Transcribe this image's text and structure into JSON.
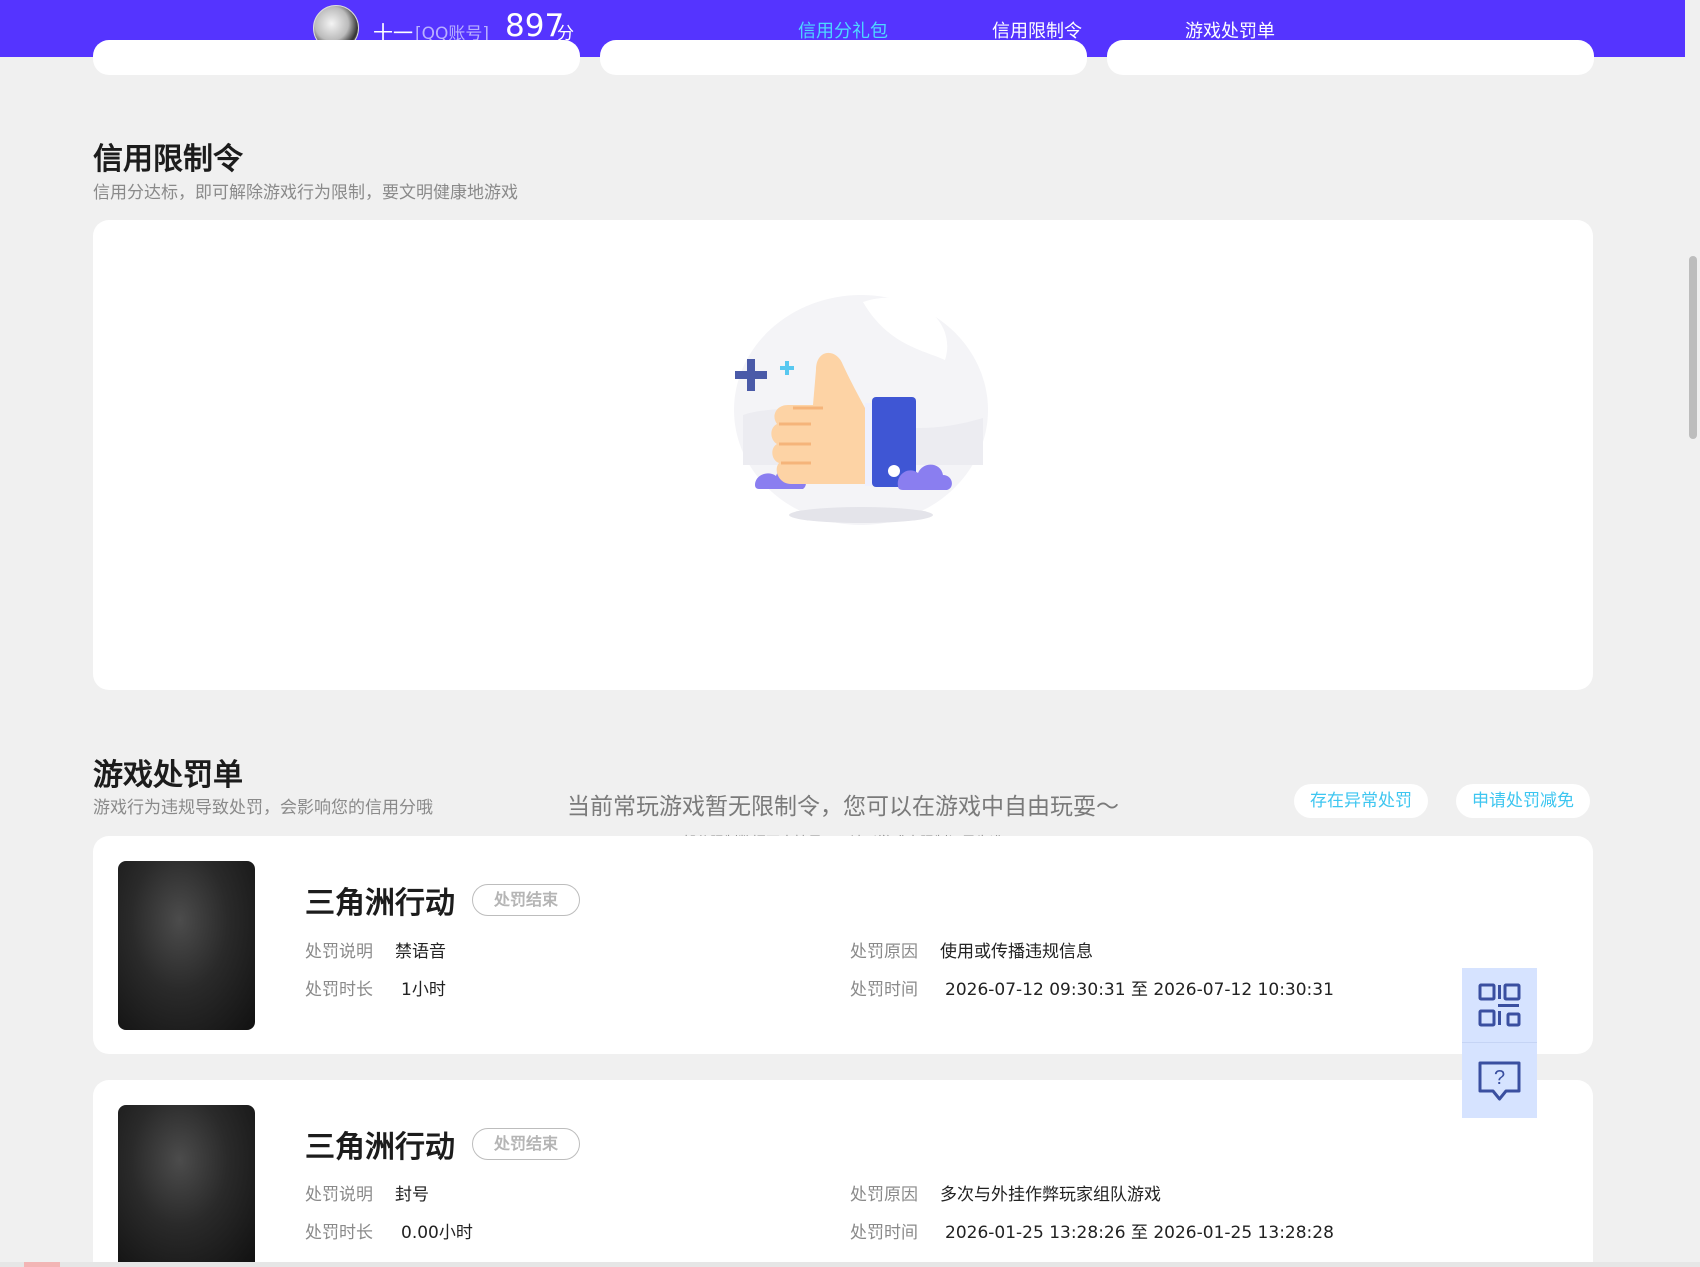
{
  "header": {
    "user_name": "十一",
    "account_type": "[QQ账号]",
    "score": "897",
    "score_unit": "分",
    "nav": [
      {
        "label": "信用分礼包",
        "active": true
      },
      {
        "label": "信用限制令",
        "active": false
      },
      {
        "label": "游戏处罚单",
        "active": false
      }
    ]
  },
  "restriction_section": {
    "title": "信用限制令",
    "subtitle": "信用分达标，即可解除游戏行为限制，要文明健康地游戏",
    "empty_message": "当前常玩游戏暂无限制令，您可以在游戏中自由玩耍～",
    "empty_note": "部分限制数据不支持显示，请以游戏内限制记录为准"
  },
  "penalty_section": {
    "title": "游戏处罚单",
    "subtitle": "游戏行为违规导致处罚，会影响您的信用分哦",
    "btn_abnormal": "存在异常处罚",
    "btn_appeal": "申请处罚减免",
    "labels": {
      "desc": "处罚说明",
      "duration": "处罚时长",
      "reason": "处罚原因",
      "time": "处罚时间"
    },
    "items": [
      {
        "game": "三角洲行动",
        "status": "处罚结束",
        "desc": "禁语音",
        "duration": "1小时",
        "reason": "使用或传播违规信息",
        "time": "2026-07-12 09:30:31 至 2026-07-12 10:30:31"
      },
      {
        "game": "三角洲行动",
        "status": "处罚结束",
        "desc": "封号",
        "duration": "0.00小时",
        "reason": "多次与外挂作弊玩家组队游戏",
        "time": "2026-01-25 13:28:26 至 2026-01-25 13:28:28"
      }
    ]
  },
  "colors": {
    "header_bg": "#5534ff",
    "accent": "#4ed8ff",
    "link": "#3ec6f0",
    "page_bg": "#f0f0f0"
  },
  "float_icons": [
    "qr-code-icon",
    "help-chat-icon"
  ]
}
